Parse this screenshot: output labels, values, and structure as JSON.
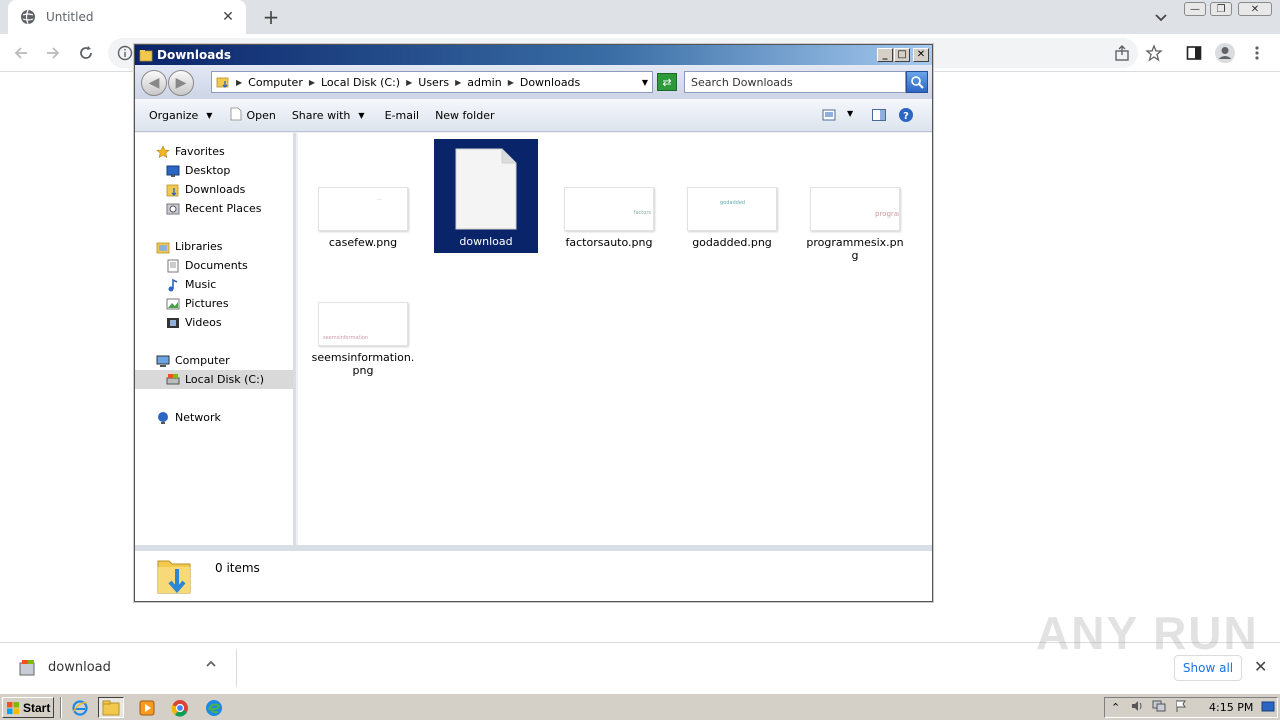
{
  "browser": {
    "tab_title": "Untitled",
    "new_tab_label": "+",
    "tab_close_label": "✕"
  },
  "explorer": {
    "title": "Downloads",
    "breadcrumb": [
      "Computer",
      "Local Disk (C:)",
      "Users",
      "admin",
      "Downloads"
    ],
    "search_placeholder": "Search Downloads",
    "commands": {
      "organize": "Organize",
      "open": "Open",
      "share_with": "Share with",
      "email": "E-mail",
      "new_folder": "New folder"
    },
    "nav": {
      "favorites": "Favorites",
      "desktop": "Desktop",
      "downloads": "Downloads",
      "recent_places": "Recent Places",
      "libraries": "Libraries",
      "documents": "Documents",
      "music": "Music",
      "pictures": "Pictures",
      "videos": "Videos",
      "computer": "Computer",
      "local_disk": "Local Disk (C:)",
      "network": "Network"
    },
    "files": [
      {
        "name": "casefew.png",
        "thumb_text": "..."
      },
      {
        "name": "download",
        "thumb_text": ""
      },
      {
        "name": "factorsauto.png",
        "thumb_text": "factors"
      },
      {
        "name": "godadded.png",
        "thumb_text": "godadded"
      },
      {
        "name": "programmesix.png",
        "thumb_text": "programme"
      },
      {
        "name": "seemsinformation.png",
        "thumb_text": "seemsinformation"
      }
    ],
    "details_count": "0 items"
  },
  "download_shelf": {
    "file_name": "download",
    "show_all": "Show all",
    "close_label": "✕"
  },
  "watermark": "ANY RUN",
  "taskbar": {
    "start_label": "Start",
    "clock": "4:15 PM"
  }
}
